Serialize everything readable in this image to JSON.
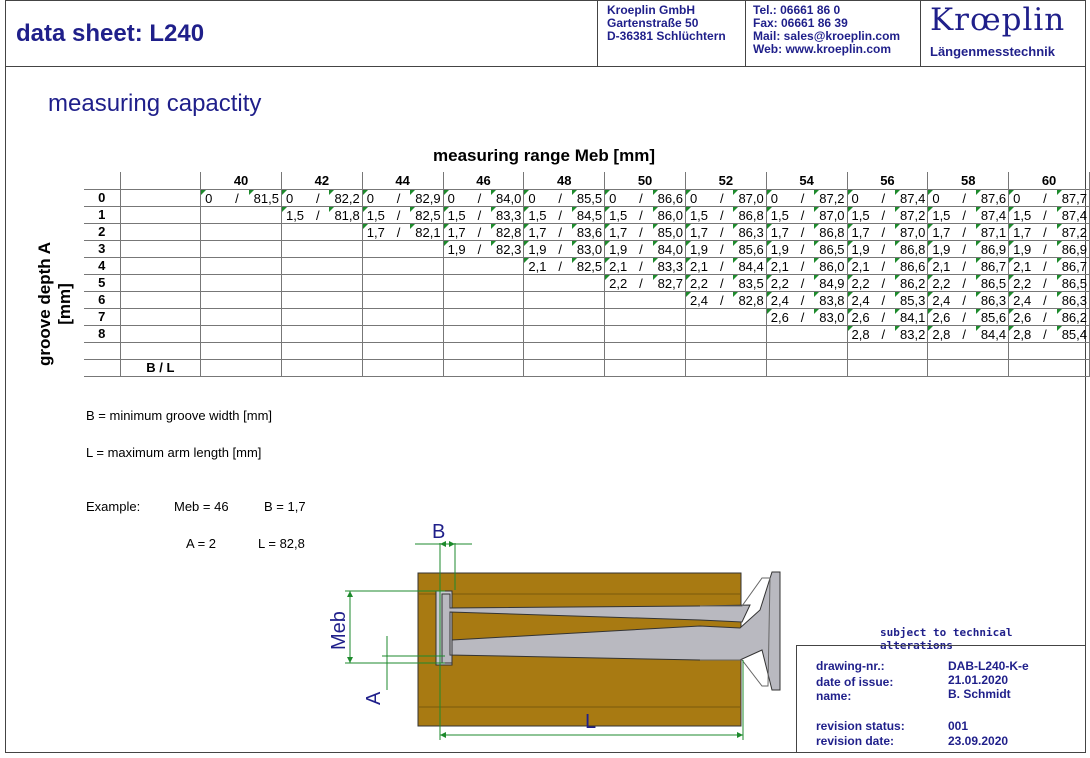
{
  "header": {
    "title": "data sheet: L240",
    "company": [
      "Kroeplin GmbH",
      "Gartenstraße 50",
      "D-36381 Schlüchtern"
    ],
    "contact": [
      "Tel.: 06661 86 0",
      "Fax: 06661 86 39",
      "Mail: sales@kroeplin.com",
      "Web: www.kroeplin.com"
    ],
    "brand": "Krœplin",
    "brand_sub": "Längenmesstechnik"
  },
  "section_title": "measuring capactity",
  "table": {
    "range_title": "measuring range Meb [mm]",
    "axis_label_1": "groove depth A",
    "axis_label_2": "[mm]",
    "columns": [
      "40",
      "42",
      "44",
      "46",
      "48",
      "50",
      "52",
      "54",
      "56",
      "58",
      "60"
    ],
    "rows": [
      {
        "label": "0",
        "cells": [
          [
            "0",
            "81,5"
          ],
          [
            "0",
            "82,2"
          ],
          [
            "0",
            "82,9"
          ],
          [
            "0",
            "84,0"
          ],
          [
            "0",
            "85,5"
          ],
          [
            "0",
            "86,6"
          ],
          [
            "0",
            "87,0"
          ],
          [
            "0",
            "87,2"
          ],
          [
            "0",
            "87,4"
          ],
          [
            "0",
            "87,6"
          ],
          [
            "0",
            "87,7"
          ]
        ]
      },
      {
        "label": "1",
        "cells": [
          null,
          [
            "1,5",
            "81,8"
          ],
          [
            "1,5",
            "82,5"
          ],
          [
            "1,5",
            "83,3"
          ],
          [
            "1,5",
            "84,5"
          ],
          [
            "1,5",
            "86,0"
          ],
          [
            "1,5",
            "86,8"
          ],
          [
            "1,5",
            "87,0"
          ],
          [
            "1,5",
            "87,2"
          ],
          [
            "1,5",
            "87,4"
          ],
          [
            "1,5",
            "87,4"
          ]
        ]
      },
      {
        "label": "2",
        "cells": [
          null,
          null,
          [
            "1,7",
            "82,1"
          ],
          [
            "1,7",
            "82,8"
          ],
          [
            "1,7",
            "83,6"
          ],
          [
            "1,7",
            "85,0"
          ],
          [
            "1,7",
            "86,3"
          ],
          [
            "1,7",
            "86,8"
          ],
          [
            "1,7",
            "87,0"
          ],
          [
            "1,7",
            "87,1"
          ],
          [
            "1,7",
            "87,2"
          ]
        ]
      },
      {
        "label": "3",
        "cells": [
          null,
          null,
          null,
          [
            "1,9",
            "82,3"
          ],
          [
            "1,9",
            "83,0"
          ],
          [
            "1,9",
            "84,0"
          ],
          [
            "1,9",
            "85,6"
          ],
          [
            "1,9",
            "86,5"
          ],
          [
            "1,9",
            "86,8"
          ],
          [
            "1,9",
            "86,9"
          ],
          [
            "1,9",
            "86,9"
          ]
        ]
      },
      {
        "label": "4",
        "cells": [
          null,
          null,
          null,
          null,
          [
            "2,1",
            "82,5"
          ],
          [
            "2,1",
            "83,3"
          ],
          [
            "2,1",
            "84,4"
          ],
          [
            "2,1",
            "86,0"
          ],
          [
            "2,1",
            "86,6"
          ],
          [
            "2,1",
            "86,7"
          ],
          [
            "2,1",
            "86,7"
          ]
        ]
      },
      {
        "label": "5",
        "cells": [
          null,
          null,
          null,
          null,
          null,
          [
            "2,2",
            "82,7"
          ],
          [
            "2,2",
            "83,5"
          ],
          [
            "2,2",
            "84,9"
          ],
          [
            "2,2",
            "86,2"
          ],
          [
            "2,2",
            "86,5"
          ],
          [
            "2,2",
            "86,5"
          ]
        ]
      },
      {
        "label": "6",
        "cells": [
          null,
          null,
          null,
          null,
          null,
          null,
          [
            "2,4",
            "82,8"
          ],
          [
            "2,4",
            "83,8"
          ],
          [
            "2,4",
            "85,3"
          ],
          [
            "2,4",
            "86,3"
          ],
          [
            "2,4",
            "86,3"
          ]
        ]
      },
      {
        "label": "7",
        "cells": [
          null,
          null,
          null,
          null,
          null,
          null,
          null,
          [
            "2,6",
            "83,0"
          ],
          [
            "2,6",
            "84,1"
          ],
          [
            "2,6",
            "85,6"
          ],
          [
            "2,6",
            "86,2"
          ]
        ]
      },
      {
        "label": "8",
        "cells": [
          null,
          null,
          null,
          null,
          null,
          null,
          null,
          null,
          [
            "2,8",
            "83,2"
          ],
          [
            "2,8",
            "84,4"
          ],
          [
            "2,8",
            "85,4"
          ]
        ]
      },
      {
        "label": "",
        "cells": [
          null,
          null,
          null,
          null,
          null,
          null,
          null,
          null,
          null,
          null,
          null
        ]
      }
    ],
    "bl_label": "B / L",
    "separator": "/"
  },
  "notes": {
    "b_def": "B = minimum groove width [mm]",
    "l_def": "L = maximum arm length [mm]",
    "example_label": "Example:",
    "example_meb": "Meb = 46",
    "example_b": "B = 1,7",
    "example_a": "A = 2",
    "example_l": "L = 82,8"
  },
  "drawing": {
    "label_b": "B",
    "label_meb": "Meb",
    "label_a": "A",
    "label_l": "L",
    "colors": {
      "body": "#a87a12",
      "dim": "#1f1f8a",
      "green": "#1d8a2c"
    }
  },
  "title_block": {
    "subject": "subject to technical alterations",
    "drawing_nr_label": "drawing-nr.:",
    "drawing_nr": "DAB-L240-K-e",
    "date_issue_label": "date of issue:",
    "date_issue": "21.01.2020",
    "name_label": "name:",
    "name": "B. Schmidt",
    "rev_status_label": "revision status:",
    "rev_status": "001",
    "rev_date_label": "revision date:",
    "rev_date": "23.09.2020"
  }
}
